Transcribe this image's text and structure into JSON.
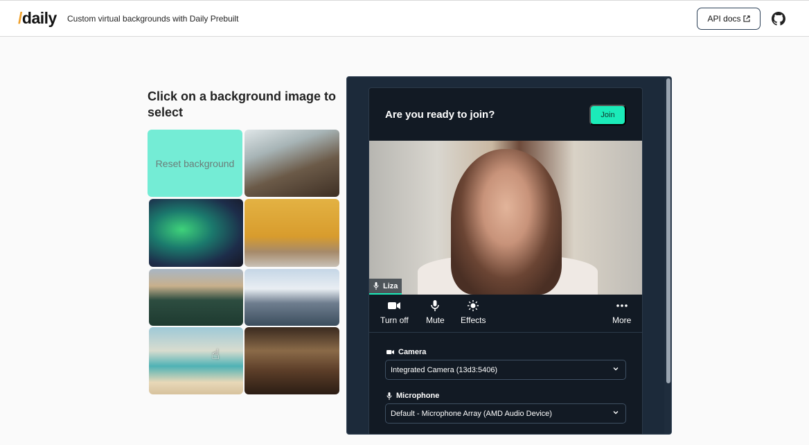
{
  "header": {
    "logo_slash": "/",
    "logo_text": "daily",
    "subtitle": "Custom virtual backgrounds with Daily Prebuilt",
    "api_docs_label": "API docs"
  },
  "picker": {
    "heading": "Click on a background image to select",
    "reset_label": "Reset background",
    "images": [
      "restaurant-window",
      "aurora-forest",
      "cafe-table-cat",
      "mountain-forest-lake",
      "snowy-mountains",
      "beach-sunset",
      "rustic-restaurant"
    ]
  },
  "call": {
    "ready_title": "Are you ready to join?",
    "join_label": "Join",
    "participant_name": "Liza",
    "controls": {
      "camera": "Turn off",
      "mute": "Mute",
      "effects": "Effects",
      "more": "More"
    },
    "camera_label": "Camera",
    "camera_value": "Integrated Camera (13d3:5406)",
    "microphone_label": "Microphone",
    "microphone_value": "Default - Microphone Array (AMD Audio Device)"
  },
  "colors": {
    "accent": "#1bebb9",
    "reset_tile": "#74ecd5",
    "panel_bg": "#1c2a3a",
    "card_bg": "#121a24",
    "logo_slash": "#f0a02a"
  }
}
